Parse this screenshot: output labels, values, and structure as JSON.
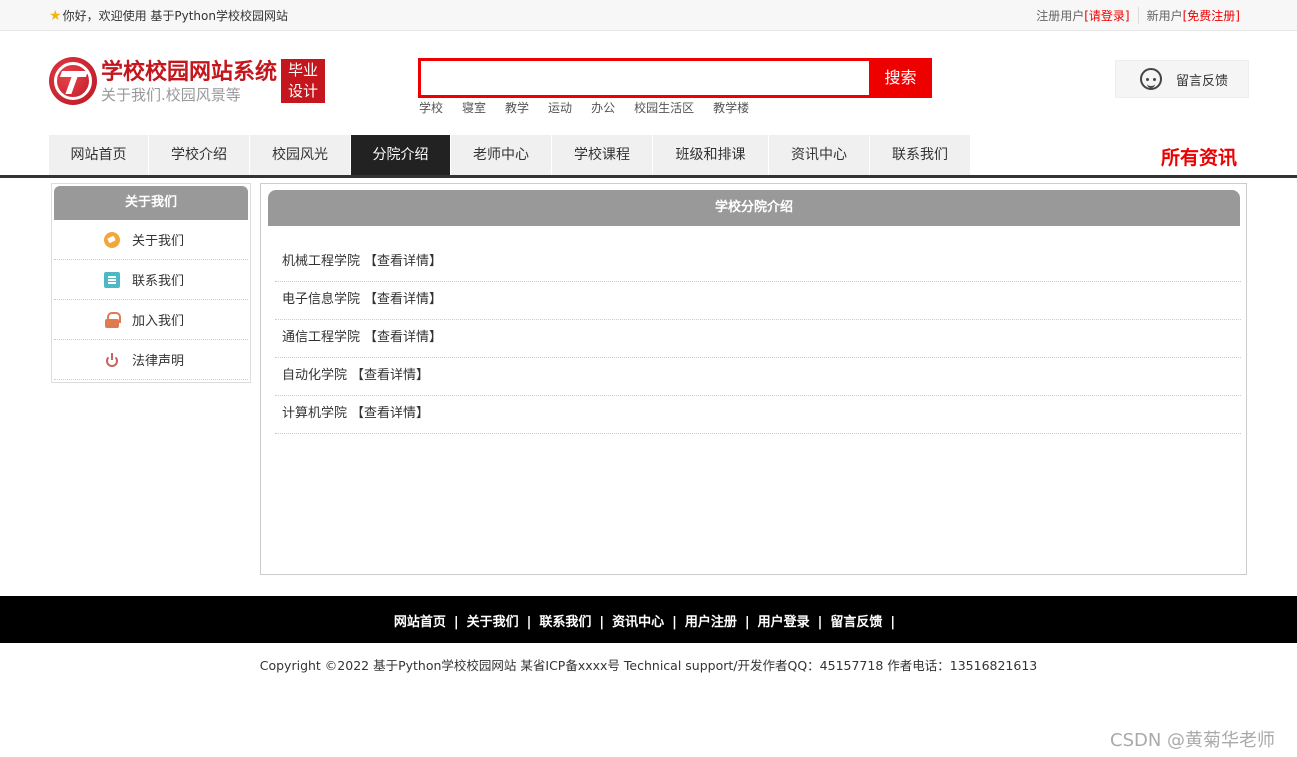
{
  "topbar": {
    "welcome": "你好，欢迎使用 基于Python学校校园网站",
    "register_user_label": "注册用户",
    "login_link": "[请登录]",
    "new_user_label": "新用户",
    "free_register_link": "[免费注册]"
  },
  "header": {
    "site_title": "学校校园网站系统",
    "site_subtitle": "关于我们.校园风景等",
    "badge_line1": "毕业",
    "badge_line2": "设计",
    "search_placeholder": "",
    "search_button": "搜索",
    "hot_words": [
      "学校",
      "寝室",
      "教学",
      "运动",
      "办公",
      "校园生活区",
      "教学楼"
    ],
    "feedback_label": "留言反馈"
  },
  "nav": {
    "items": [
      {
        "label": "网站首页",
        "w": 100
      },
      {
        "label": "学校介绍",
        "w": 101
      },
      {
        "label": "校园风光",
        "w": 101
      },
      {
        "label": "分院介绍",
        "w": 100,
        "active": true
      },
      {
        "label": "老师中心",
        "w": 101
      },
      {
        "label": "学校课程",
        "w": 101
      },
      {
        "label": "班级和排课",
        "w": 116
      },
      {
        "label": "资讯中心",
        "w": 101
      },
      {
        "label": "联系我们",
        "w": 101
      }
    ],
    "right_label": "所有资讯"
  },
  "sidebar": {
    "title": "关于我们",
    "items": [
      {
        "label": "关于我们",
        "icon": "about-icon"
      },
      {
        "label": "联系我们",
        "icon": "contact-icon"
      },
      {
        "label": "加入我们",
        "icon": "lock-icon"
      },
      {
        "label": "法律声明",
        "icon": "power-icon"
      }
    ]
  },
  "main": {
    "title": "学校分院介绍",
    "detail_link": "【查看详情】",
    "colleges": [
      "机械工程学院",
      "电子信息学院",
      "通信工程学院",
      "自动化学院",
      "计算机学院"
    ]
  },
  "footer": {
    "links": [
      "网站首页",
      "关于我们",
      "联系我们",
      "资讯中心",
      "用户注册",
      "用户登录",
      "留言反馈"
    ],
    "separator": "|",
    "copyright": "Copyright ©2022 基于Python学校校园网站 某省ICP备xxxx号    Technical support/开发作者QQ：45157718     作者电话：13516821613"
  },
  "watermark": "CSDN @黄菊华老师"
}
